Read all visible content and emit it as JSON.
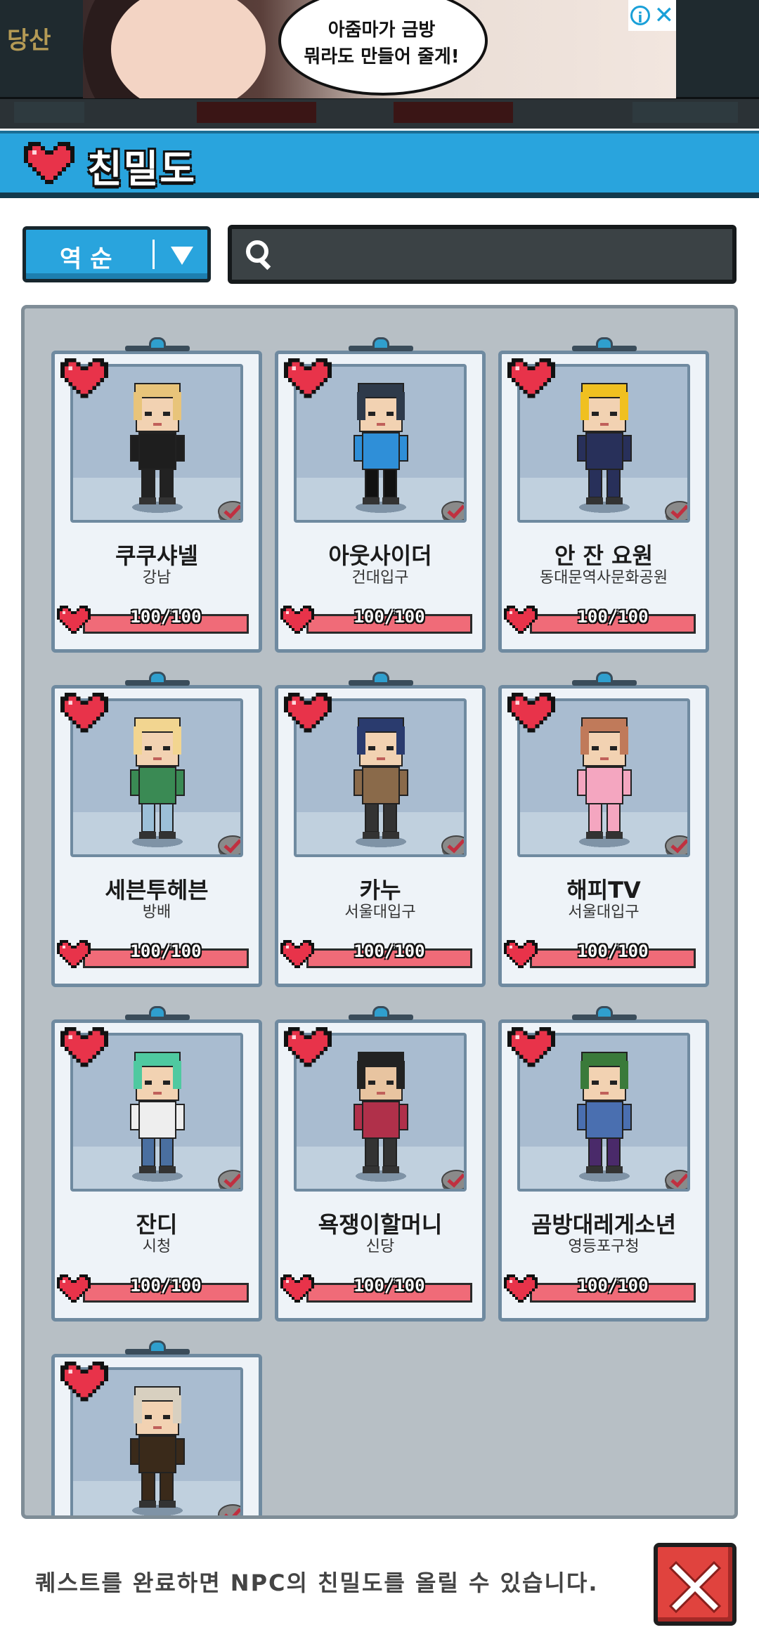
{
  "background": {
    "station_fragment": "당산"
  },
  "ad": {
    "text_line1": "아줌마가 금방",
    "text_line2": "뭐라도 만들어 줄게!",
    "info_icon": "info-icon",
    "close_icon": "close-icon"
  },
  "header": {
    "title": "친밀도",
    "icon": "heart-icon",
    "color": "#29a4dd"
  },
  "controls": {
    "sort_label": "역순",
    "search_placeholder": "",
    "search_value": ""
  },
  "cards": [
    {
      "name": "쿠쿠샤넬",
      "location": "강남",
      "affinity_text": "100/100",
      "affinity": 100,
      "max": 100
    },
    {
      "name": "아웃사이더",
      "location": "건대입구",
      "affinity_text": "100/100",
      "affinity": 100,
      "max": 100
    },
    {
      "name": "안 잔 요원",
      "location": "동대문역사문화공원",
      "affinity_text": "100/100",
      "affinity": 100,
      "max": 100
    },
    {
      "name": "세븐투헤븐",
      "location": "방배",
      "affinity_text": "100/100",
      "affinity": 100,
      "max": 100
    },
    {
      "name": "카누",
      "location": "서울대입구",
      "affinity_text": "100/100",
      "affinity": 100,
      "max": 100
    },
    {
      "name": "해피TV",
      "location": "서울대입구",
      "affinity_text": "100/100",
      "affinity": 100,
      "max": 100
    },
    {
      "name": "잔디",
      "location": "시청",
      "affinity_text": "100/100",
      "affinity": 100,
      "max": 100
    },
    {
      "name": "욕쟁이할머니",
      "location": "신당",
      "affinity_text": "100/100",
      "affinity": 100,
      "max": 100
    },
    {
      "name": "곰방대레게소년",
      "location": "영등포구청",
      "affinity_text": "100/100",
      "affinity": 100,
      "max": 100
    },
    {
      "name": "",
      "location": "",
      "affinity_text": "",
      "affinity": null,
      "max": 100
    }
  ],
  "footer": {
    "message": "퀘스트를 완료하면 NPC의 친밀도를 올릴 수 있습니다.",
    "close_icon": "close-icon"
  },
  "colors": {
    "accent": "#29a4dd",
    "heart": "#e8334a",
    "bar_fill": "#f06b78",
    "close": "#e0433e"
  }
}
